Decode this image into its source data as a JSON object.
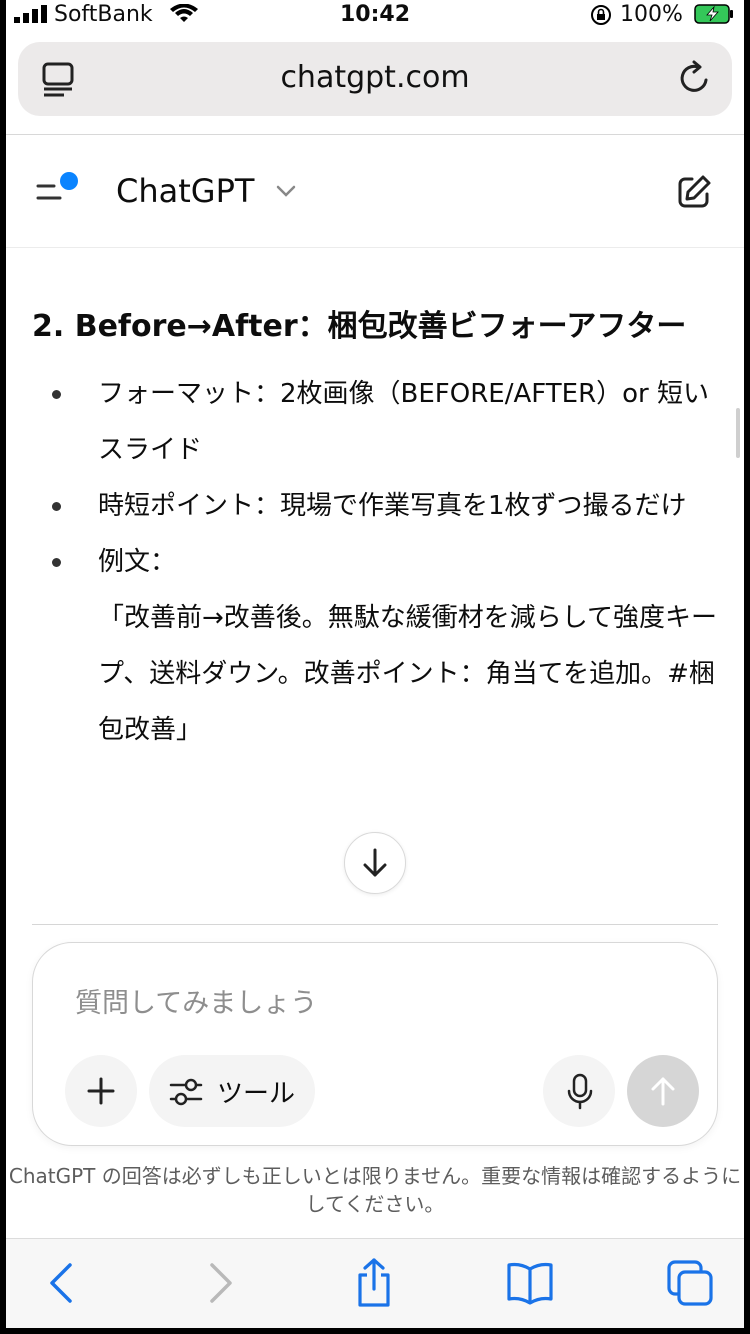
{
  "status_bar": {
    "carrier": "SoftBank",
    "time": "10:42",
    "battery_percent": "100%"
  },
  "browser": {
    "url": "chatgpt.com"
  },
  "chatgpt": {
    "title": "ChatGPT"
  },
  "content": {
    "heading": "2. Before→After：梱包改善ビフォーアフター",
    "bullets": [
      {
        "text": "フォーマット：2枚画像（BEFORE/AFTER）or 短いスライド"
      },
      {
        "text": "時短ポイント：現場で作業写真を1枚ずつ撮るだけ"
      },
      {
        "text": "例文：",
        "quote": "「改善前→改善後。無駄な緩衝材を減らして強度キープ、送料ダウン。改善ポイント：角当てを追加。#梱包改善」"
      }
    ]
  },
  "composer": {
    "placeholder": "質問してみましょう",
    "tools_label": "ツール"
  },
  "disclaimer": "ChatGPT の回答は必ずしも正しいとは限りません。重要な情報は確認するようにしてください。",
  "icons": {
    "reader": "reader-icon",
    "reload": "reload-icon",
    "menu": "sidebar-menu-icon",
    "edit": "new-chat-icon",
    "scroll": "arrow-down-icon",
    "plus": "plus-icon",
    "tools": "sliders-icon",
    "mic": "microphone-icon",
    "send": "arrow-up-icon",
    "back": "back-icon",
    "forward": "forward-icon",
    "share": "share-icon",
    "bookmarks": "bookmarks-icon",
    "tabs": "tabs-icon"
  },
  "colors": {
    "accent_dot": "#0a84ff",
    "safari_blue": "#1a73e8",
    "send_disabled": "#d6d6d6"
  }
}
